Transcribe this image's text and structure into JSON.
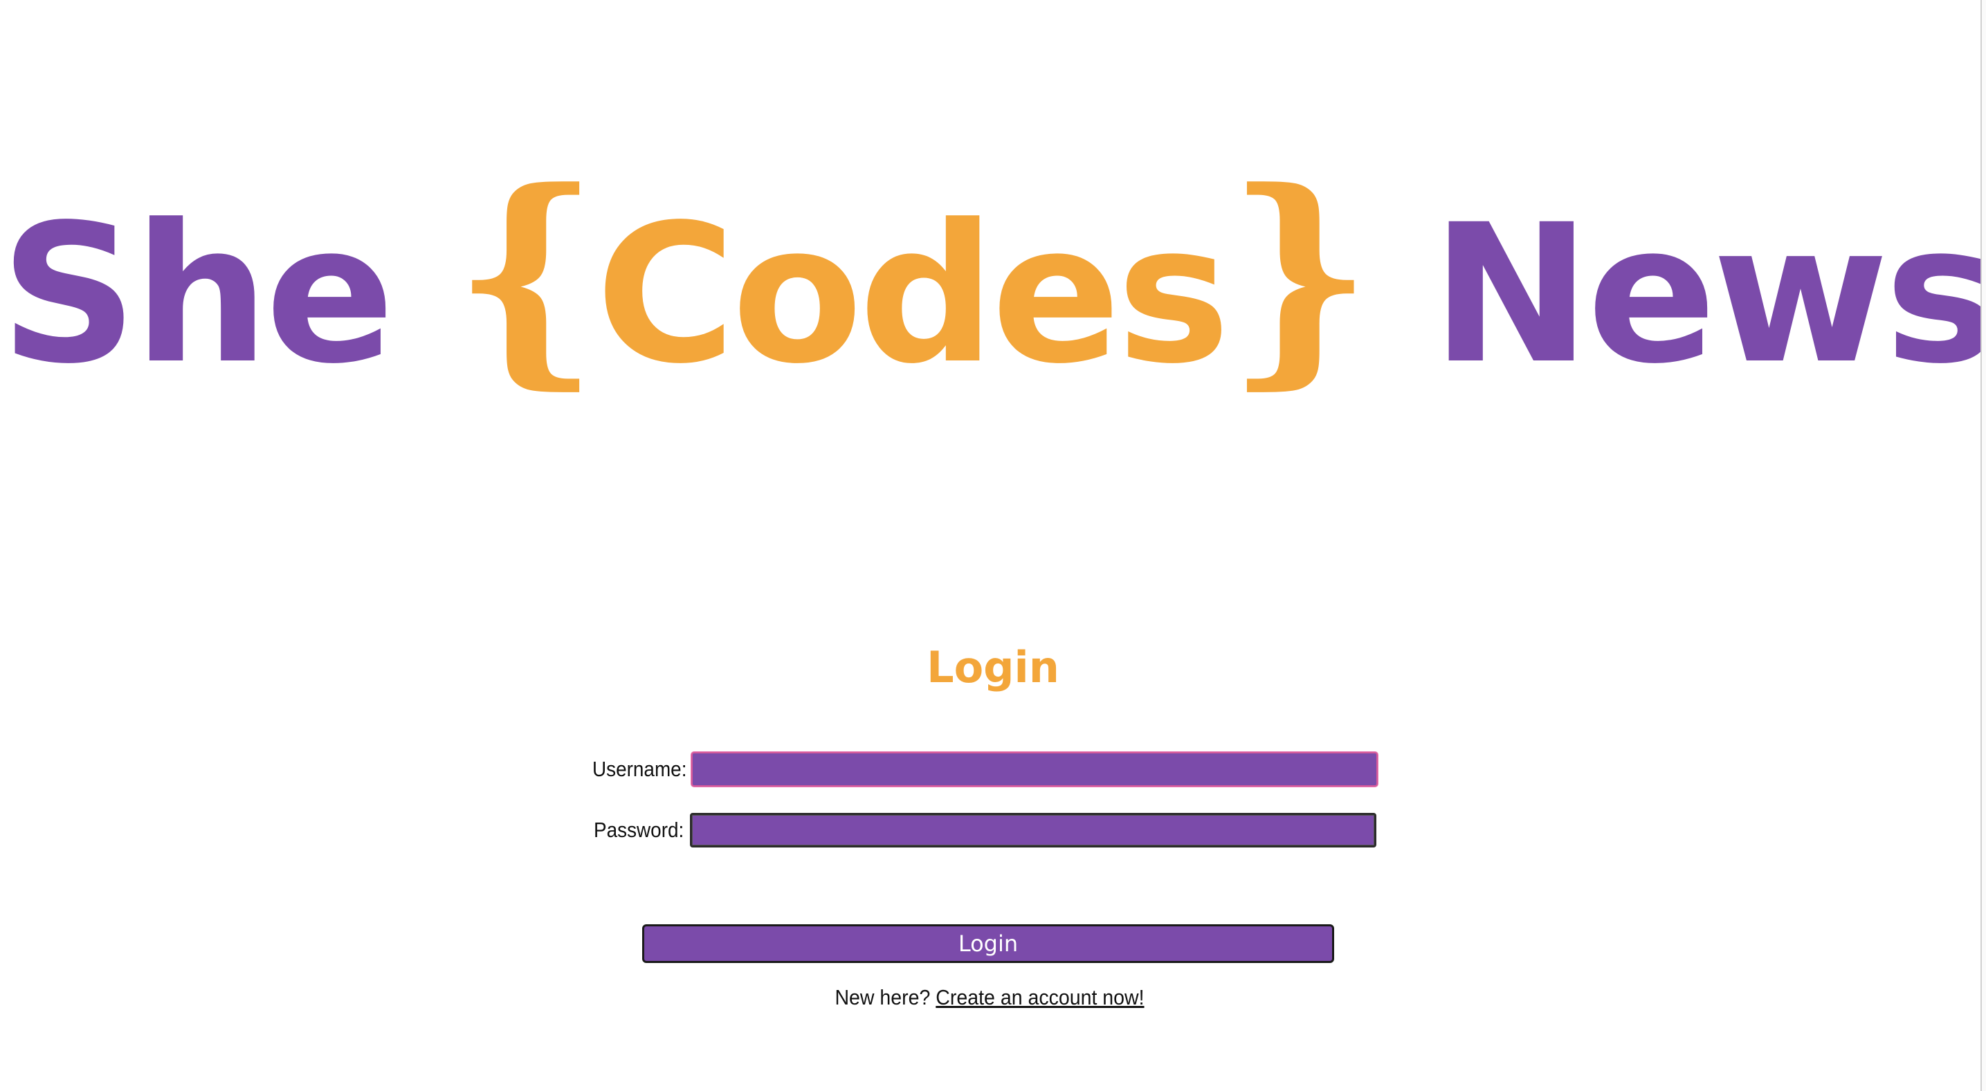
{
  "header": {
    "logo_she": "She",
    "logo_brace_open": "{",
    "logo_codes": "Codes",
    "logo_brace_close": "}",
    "logo_news": "News"
  },
  "login_form": {
    "title": "Login",
    "username_label": "Username:",
    "username_value": "",
    "password_label": "Password:",
    "password_value": "",
    "submit_label": "Login"
  },
  "signup": {
    "prompt": "New here?",
    "link_text": "Create an account now!"
  },
  "colors": {
    "brand_purple": "#7b4baa",
    "brand_orange": "#f3a63a",
    "background": "#ffffff"
  }
}
